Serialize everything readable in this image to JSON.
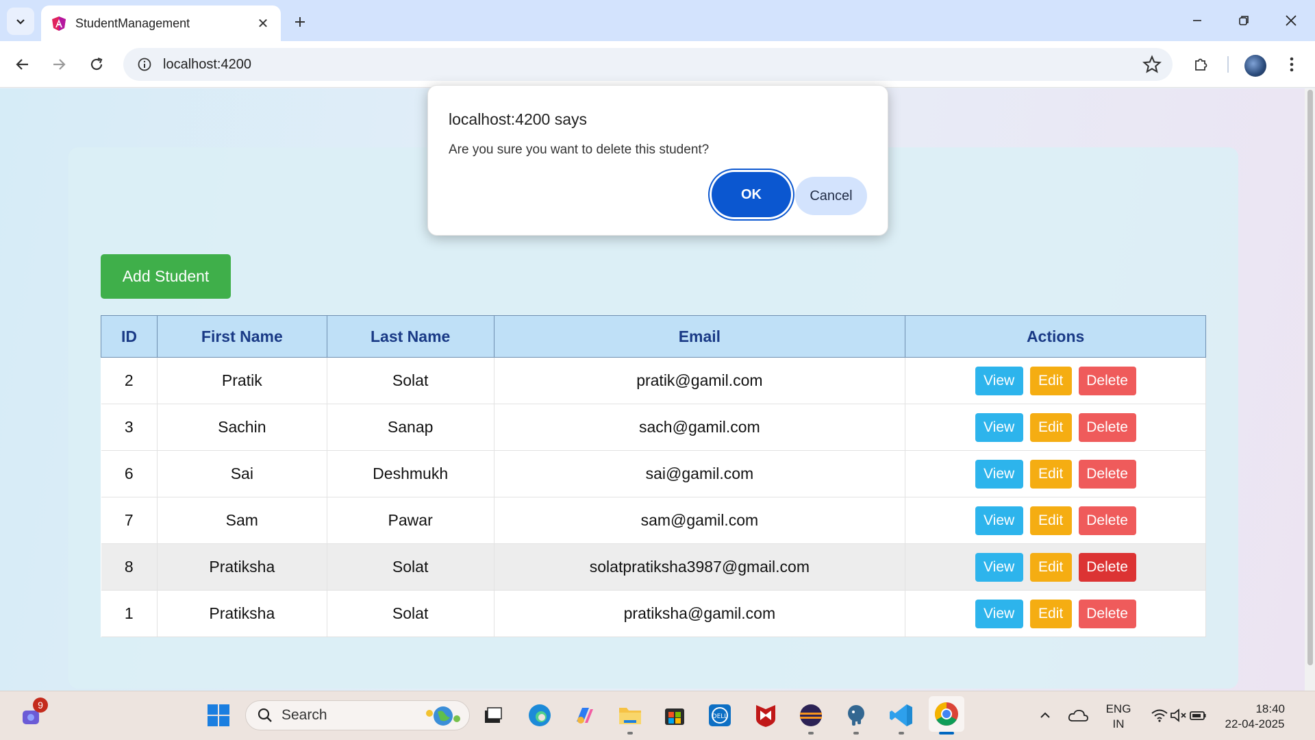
{
  "browser": {
    "tab_title": "StudentManagement",
    "url": "localhost:4200"
  },
  "page": {
    "add_button": "Add Student",
    "table": {
      "headers": [
        "ID",
        "First Name",
        "Last Name",
        "Email",
        "Actions"
      ],
      "rows": [
        {
          "id": "2",
          "first": "Pratik",
          "last": "Solat",
          "email": "pratik@gamil.com"
        },
        {
          "id": "3",
          "first": "Sachin",
          "last": "Sanap",
          "email": "sach@gamil.com"
        },
        {
          "id": "6",
          "first": "Sai",
          "last": "Deshmukh",
          "email": "sai@gamil.com"
        },
        {
          "id": "7",
          "first": "Sam",
          "last": "Pawar",
          "email": "sam@gamil.com"
        },
        {
          "id": "8",
          "first": "Pratiksha",
          "last": "Solat",
          "email": "solatpratiksha3987@gmail.com"
        },
        {
          "id": "1",
          "first": "Pratiksha",
          "last": "Solat",
          "email": "pratiksha@gamil.com"
        }
      ],
      "actions": {
        "view": "View",
        "edit": "Edit",
        "delete": "Delete"
      }
    }
  },
  "dialog": {
    "title": "localhost:4200 says",
    "message": "Are you sure you want to delete this student?",
    "ok": "OK",
    "cancel": "Cancel"
  },
  "taskbar": {
    "notification_count": "9",
    "search_placeholder": "Search",
    "language": "ENG",
    "region": "IN",
    "time": "18:40",
    "date": "22-04-2025"
  },
  "colors": {
    "add_button": "#3faf4a",
    "view_button": "#2db4ec",
    "edit_button": "#f5ad12",
    "delete_button": "#ef5b5b",
    "dialog_ok": "#0b57d0",
    "table_header_bg": "#bfe0f7"
  }
}
